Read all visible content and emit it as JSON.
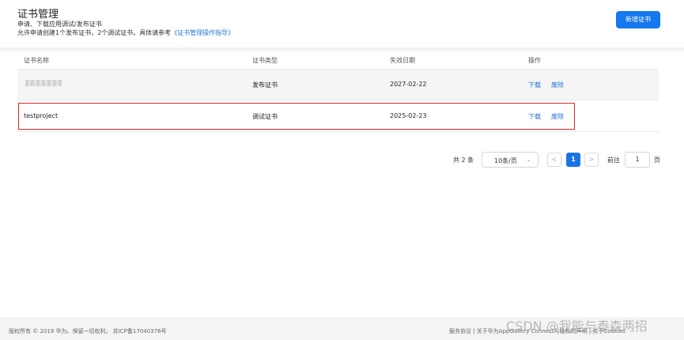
{
  "header": {
    "title": "证书管理",
    "desc_line1": "申请、下载应用调试/发布证书",
    "desc_line2_prefix": "允许申请创建1个发布证书，2个调试证书，具体请参考",
    "desc_link": "《证书管理操作指导》",
    "new_button": "新增证书"
  },
  "table": {
    "columns": [
      "证书名称",
      "证书类型",
      "失效日期",
      "操作"
    ],
    "rows": [
      {
        "name": "",
        "type": "发布证书",
        "expiry": "2027-02-22",
        "download": "下载",
        "revoke": "废除"
      },
      {
        "name": "testproject",
        "type": "调试证书",
        "expiry": "2025-02-23",
        "download": "下载",
        "revoke": "废除"
      }
    ]
  },
  "pagination": {
    "total": "共 2 条",
    "page_size": "10条/页",
    "prev": "<",
    "current": "1",
    "next": ">",
    "goto_label": "前往",
    "goto_value": "1",
    "page_unit": "页"
  },
  "footer": {
    "copyright": "版权所有 © 2019 华为。保留一切权利。 苏ICP备17040376号",
    "links": "服务协议 | 关于华为AppGallery Connect与隐私的声明 | 关于Cookies"
  },
  "watermark": "CSDN @我能与泰森两招",
  "colors": {
    "accent": "#1578ef",
    "highlight_border": "#d9262c"
  }
}
